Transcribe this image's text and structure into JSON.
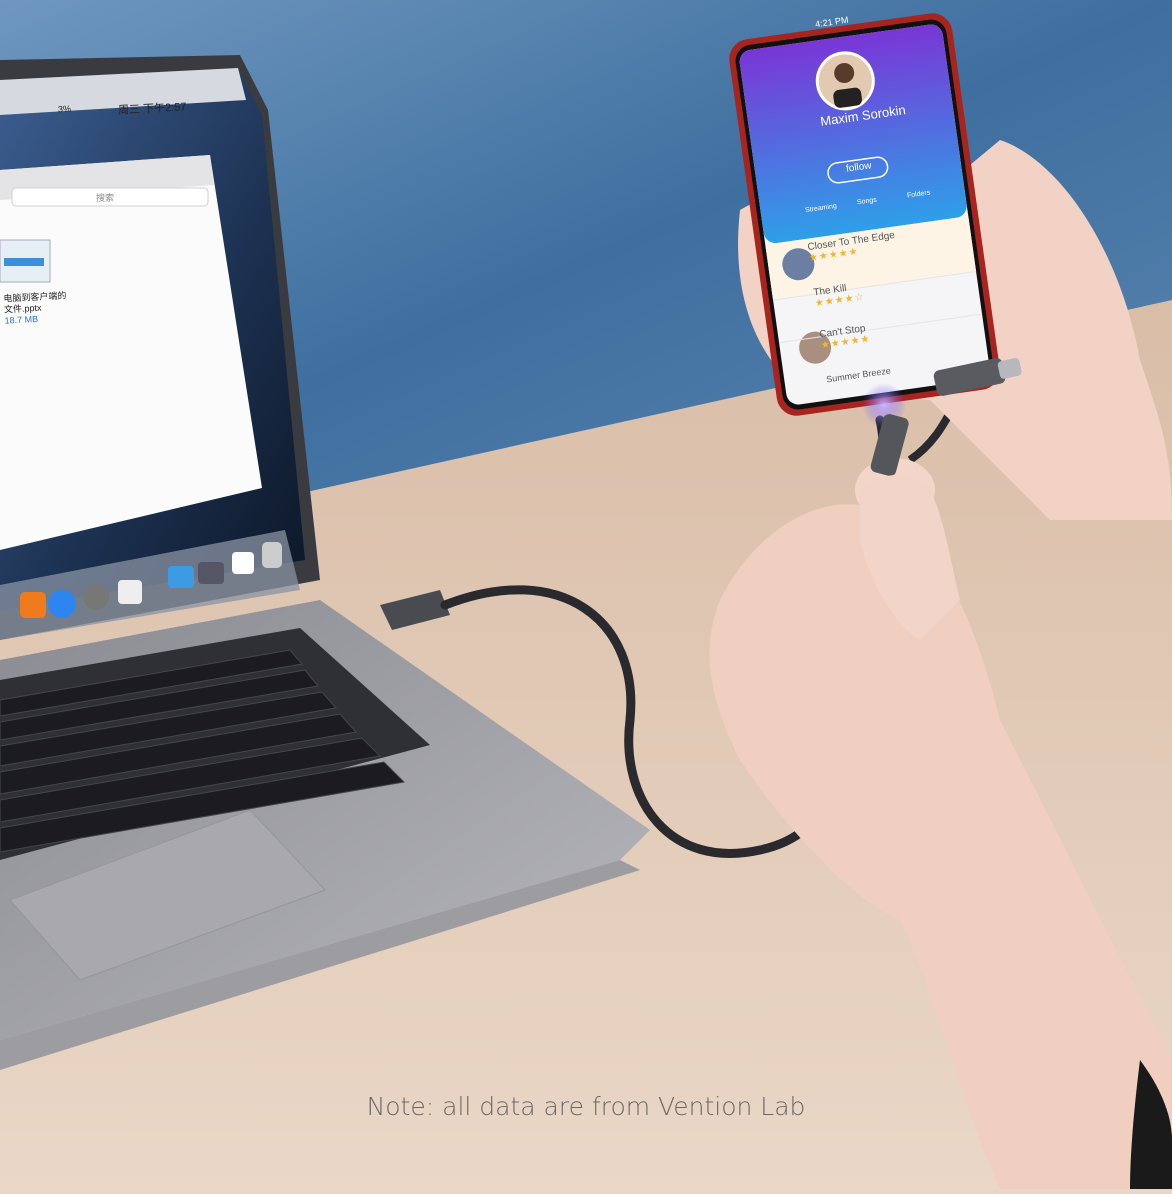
{
  "caption": "Note: all data are from Vention Lab",
  "laptop": {
    "menubar_clock": "周三 下午2:57",
    "battery": "3%",
    "search_placeholder": "搜索",
    "file_name_line1": "电脑到客户端的",
    "file_name_line2": "文件.pptx",
    "file_size": "18.7 MB"
  },
  "phone": {
    "status_time": "4:21 PM",
    "profile_name": "Maxim Sorokin",
    "follow_label": "follow",
    "stats": [
      "Streaming",
      "Songs",
      "Folders"
    ],
    "tracks": [
      {
        "title": "Closer To The Edge",
        "rating_text": "★★★★★"
      },
      {
        "title": "The Kill",
        "rating_text": "★★★★☆"
      },
      {
        "title": "Can't Stop",
        "rating_text": "★★★★★"
      },
      {
        "title": "Summer Breeze",
        "rating_text": ""
      }
    ]
  },
  "colors": {
    "wall": "#4f7fae",
    "desk": "#e6cfbd",
    "laptop_body": "#9b9ca3",
    "phone_gradient_top": "#6e3fd3",
    "phone_gradient_bottom": "#3a9be8",
    "cable": "#2b2b2f",
    "skin": "#f1d2c4"
  }
}
